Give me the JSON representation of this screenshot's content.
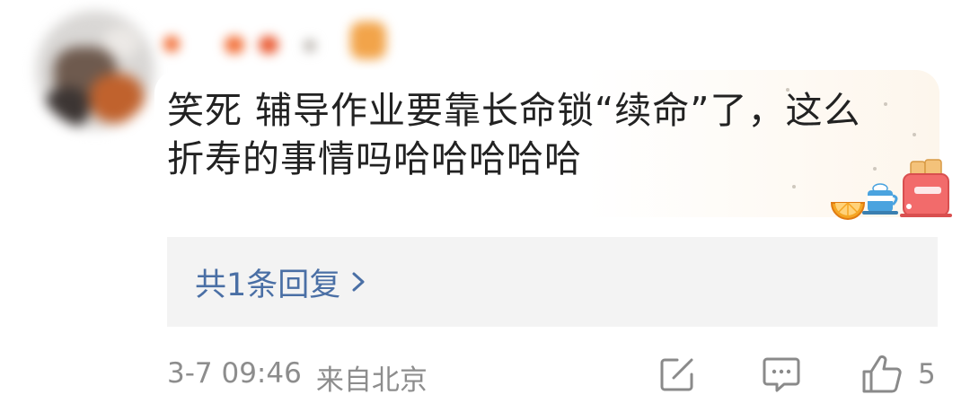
{
  "comment": {
    "text_line1": "笑死 辅导作业要靠长命锁“续命”了，这么",
    "text_line2": "折寿的事情吗哈哈哈哈哈"
  },
  "replies": {
    "label": "共1条回复"
  },
  "meta": {
    "time": "3-7 09:46",
    "location": "来自北京"
  },
  "actions": {
    "like_count": "5",
    "edit_icon": "edit-square-icon",
    "comment_icon": "comment-bubble-icon",
    "like_icon": "thumbs-up-icon"
  },
  "colors": {
    "link": "#4a6fa5",
    "meta": "#8d8d8d",
    "reply_bg": "#f3f3f3",
    "text": "#222222"
  }
}
